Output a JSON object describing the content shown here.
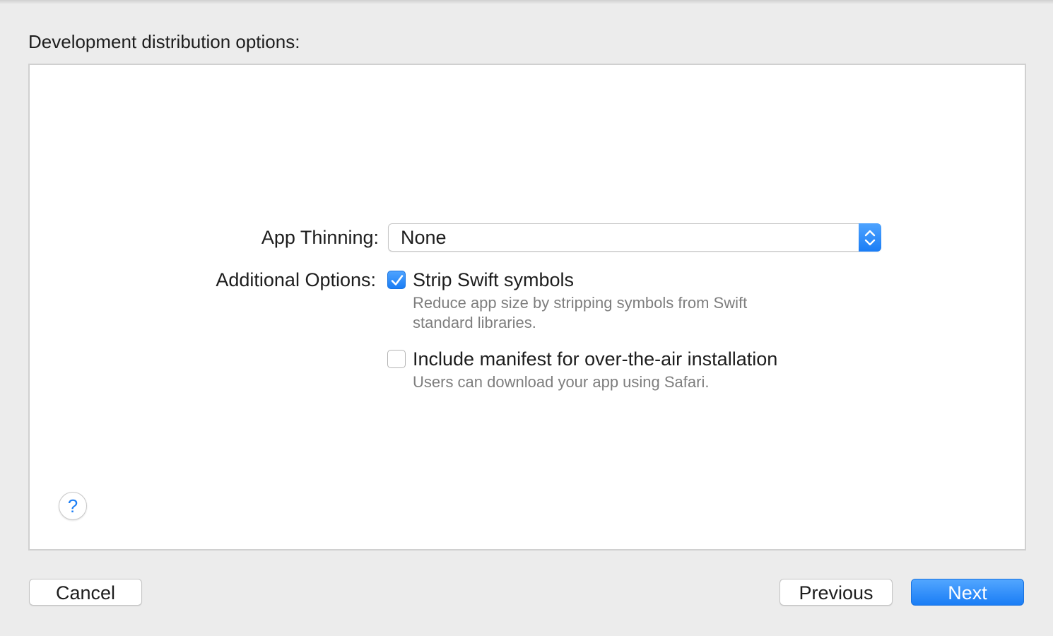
{
  "header": {
    "title": "Development distribution options:"
  },
  "form": {
    "app_thinning": {
      "label": "App Thinning:",
      "value": "None",
      "stepper_icon": "up-down-chevron-icon"
    },
    "additional_options": {
      "label": "Additional Options:",
      "options": [
        {
          "title": "Strip Swift symbols",
          "description": "Reduce app size by stripping symbols from Swift standard libraries.",
          "checked": true
        },
        {
          "title": "Include manifest for over-the-air installation",
          "description": "Users can download your app using Safari.",
          "checked": false
        }
      ]
    }
  },
  "help": {
    "glyph": "?"
  },
  "footer": {
    "cancel_label": "Cancel",
    "previous_label": "Previous",
    "next_label": "Next"
  },
  "colors": {
    "accent": "#1a7df5",
    "background": "#ececec",
    "panel": "#ffffff",
    "secondary_text": "#7e7e7e"
  }
}
